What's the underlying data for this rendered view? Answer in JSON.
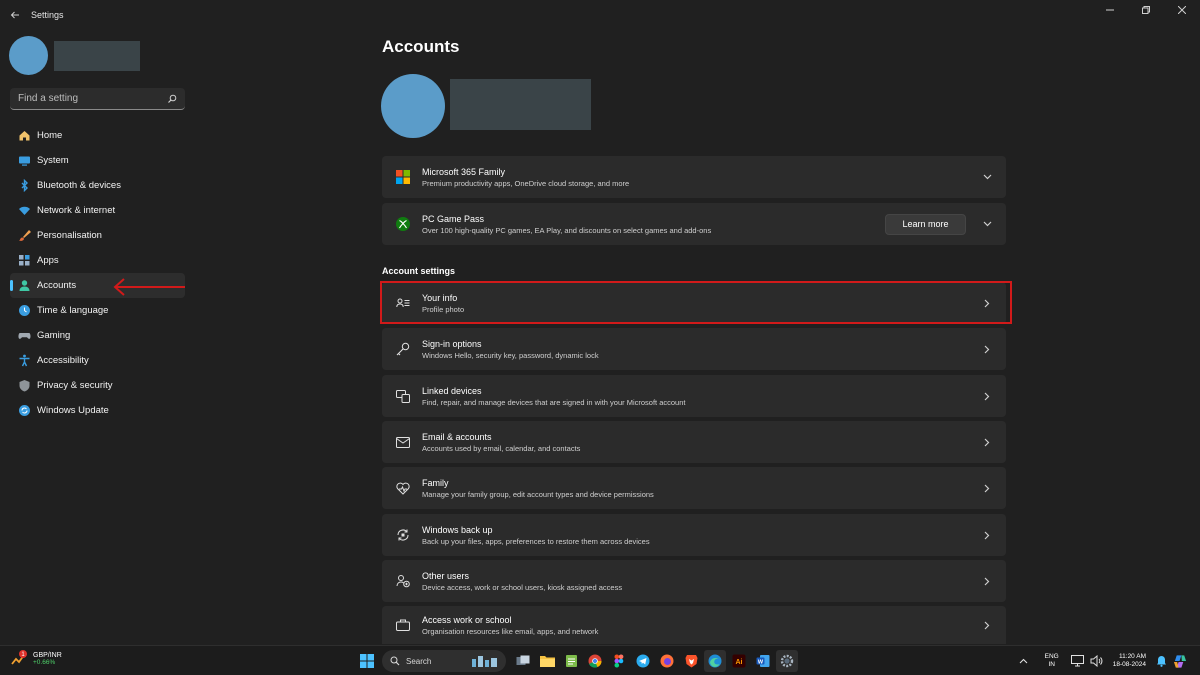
{
  "window": {
    "title": "Settings"
  },
  "sidebar": {
    "search_placeholder": "Find a setting",
    "items": [
      {
        "label": "Home",
        "icon": "home-icon"
      },
      {
        "label": "System",
        "icon": "system-icon"
      },
      {
        "label": "Bluetooth & devices",
        "icon": "bluetooth-icon"
      },
      {
        "label": "Network & internet",
        "icon": "wifi-icon"
      },
      {
        "label": "Personalisation",
        "icon": "brush-icon"
      },
      {
        "label": "Apps",
        "icon": "apps-icon"
      },
      {
        "label": "Accounts",
        "icon": "person-icon",
        "active": true
      },
      {
        "label": "Time & language",
        "icon": "globe-clock-icon"
      },
      {
        "label": "Gaming",
        "icon": "controller-icon"
      },
      {
        "label": "Accessibility",
        "icon": "accessibility-icon"
      },
      {
        "label": "Privacy & security",
        "icon": "shield-icon"
      },
      {
        "label": "Windows Update",
        "icon": "update-icon"
      }
    ]
  },
  "main": {
    "title": "Accounts",
    "promos": [
      {
        "title": "Microsoft 365 Family",
        "subtitle": "Premium productivity apps, OneDrive cloud storage, and more",
        "icon": "microsoft-logo-icon"
      },
      {
        "title": "PC Game Pass",
        "subtitle": "Over 100 high-quality PC games, EA Play, and discounts on select games and add-ons",
        "icon": "xbox-icon",
        "button": "Learn more"
      }
    ],
    "section_label": "Account settings",
    "settings": [
      {
        "title": "Your info",
        "subtitle": "Profile photo",
        "icon": "contact-card-icon"
      },
      {
        "title": "Sign-in options",
        "subtitle": "Windows Hello, security key, password, dynamic lock",
        "icon": "key-icon"
      },
      {
        "title": "Linked devices",
        "subtitle": "Find, repair, and manage devices that are signed in with your Microsoft account",
        "icon": "devices-icon"
      },
      {
        "title": "Email & accounts",
        "subtitle": "Accounts used by email, calendar, and contacts",
        "icon": "mail-icon"
      },
      {
        "title": "Family",
        "subtitle": "Manage your family group, edit account types and device permissions",
        "icon": "heart-icon"
      },
      {
        "title": "Windows back up",
        "subtitle": "Back up your files, apps, preferences to restore them across devices",
        "icon": "backup-icon"
      },
      {
        "title": "Other users",
        "subtitle": "Device access, work or school users, kiosk assigned access",
        "icon": "people-icon"
      },
      {
        "title": "Access work or school",
        "subtitle": "Organisation resources like email, apps, and network",
        "icon": "briefcase-icon"
      }
    ]
  },
  "taskbar": {
    "widget_title": "GBP/INR",
    "widget_value": "+0.66%",
    "widget_badge": "1",
    "search_label": "Search",
    "lang_line1": "ENG",
    "lang_line2": "IN",
    "time": "11:20 AM",
    "date": "18-08-2024"
  },
  "colors": {
    "accent": "#4cc2ff",
    "highlight": "#d11a1a",
    "background": "#202020",
    "card": "#2b2b2b"
  }
}
